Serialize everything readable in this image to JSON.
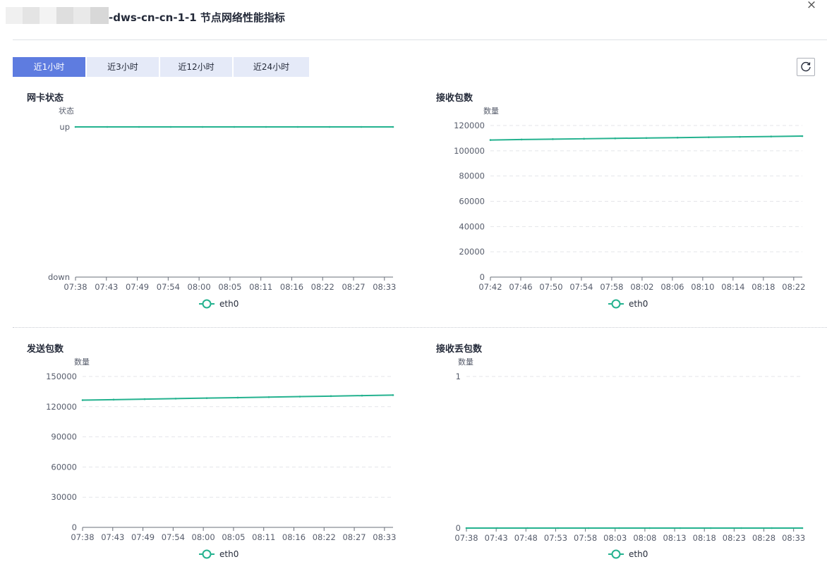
{
  "dialog": {
    "title": "-dws-cn-cn-1-1  节点网络性能指标",
    "close_label": "×"
  },
  "time_tabs": [
    {
      "label": "近1小时",
      "active": true
    },
    {
      "label": "近3小时",
      "active": false
    },
    {
      "label": "近12小时",
      "active": false
    },
    {
      "label": "近24小时",
      "active": false
    }
  ],
  "icons": {
    "close": "close-icon",
    "refresh": "refresh-icon",
    "legend_marker": "circle-line-legend-icon"
  },
  "colors": {
    "accent": "#5e7ce0",
    "series": "#24b28f",
    "tab_inactive": "#e5eaf8"
  },
  "chart_data": [
    {
      "type": "line",
      "title": "网卡状态",
      "ylabel": "状态",
      "y_type": "category",
      "y_categories": [
        "down",
        "up"
      ],
      "x": [
        "07:38",
        "07:43",
        "07:49",
        "07:54",
        "08:00",
        "08:05",
        "08:11",
        "08:16",
        "08:22",
        "08:27",
        "08:33"
      ],
      "series": [
        {
          "name": "eth0",
          "values": [
            "up",
            "up",
            "up",
            "up",
            "up",
            "up",
            "up",
            "up",
            "up",
            "up",
            "up"
          ]
        }
      ],
      "grid": false,
      "legend": "bottom-center"
    },
    {
      "type": "line",
      "title": "接收包数",
      "ylabel": "数量",
      "ylim": [
        0,
        120000
      ],
      "yticks": [
        0,
        20000,
        40000,
        60000,
        80000,
        100000,
        120000
      ],
      "x": [
        "07:42",
        "07:46",
        "07:50",
        "07:54",
        "07:58",
        "08:02",
        "08:06",
        "08:10",
        "08:14",
        "08:18",
        "08:22"
      ],
      "series": [
        {
          "name": "eth0",
          "values": [
            108500,
            108900,
            109200,
            109500,
            109800,
            110100,
            110400,
            110700,
            111000,
            111300,
            111600
          ]
        }
      ],
      "grid": true,
      "legend": "bottom-center"
    },
    {
      "type": "line",
      "title": "发送包数",
      "ylabel": "数量",
      "ylim": [
        0,
        150000
      ],
      "yticks": [
        0,
        30000,
        60000,
        90000,
        120000,
        150000
      ],
      "x": [
        "07:38",
        "07:43",
        "07:49",
        "07:54",
        "08:00",
        "08:05",
        "08:11",
        "08:16",
        "08:22",
        "08:27",
        "08:33"
      ],
      "series": [
        {
          "name": "eth0",
          "values": [
            126500,
            127000,
            127500,
            128000,
            128500,
            129000,
            129500,
            130000,
            130500,
            131000,
            131500
          ]
        }
      ],
      "grid": true,
      "legend": "bottom-center"
    },
    {
      "type": "line",
      "title": "接收丢包数",
      "ylabel": "数量",
      "ylim": [
        0,
        1
      ],
      "yticks": [
        0,
        1
      ],
      "x": [
        "07:38",
        "07:43",
        "07:48",
        "07:53",
        "07:58",
        "08:03",
        "08:08",
        "08:13",
        "08:18",
        "08:23",
        "08:28",
        "08:33"
      ],
      "series": [
        {
          "name": "eth0",
          "values": [
            0,
            0,
            0,
            0,
            0,
            0,
            0,
            0,
            0,
            0,
            0,
            0
          ]
        }
      ],
      "grid": true,
      "legend": "bottom-center"
    }
  ]
}
